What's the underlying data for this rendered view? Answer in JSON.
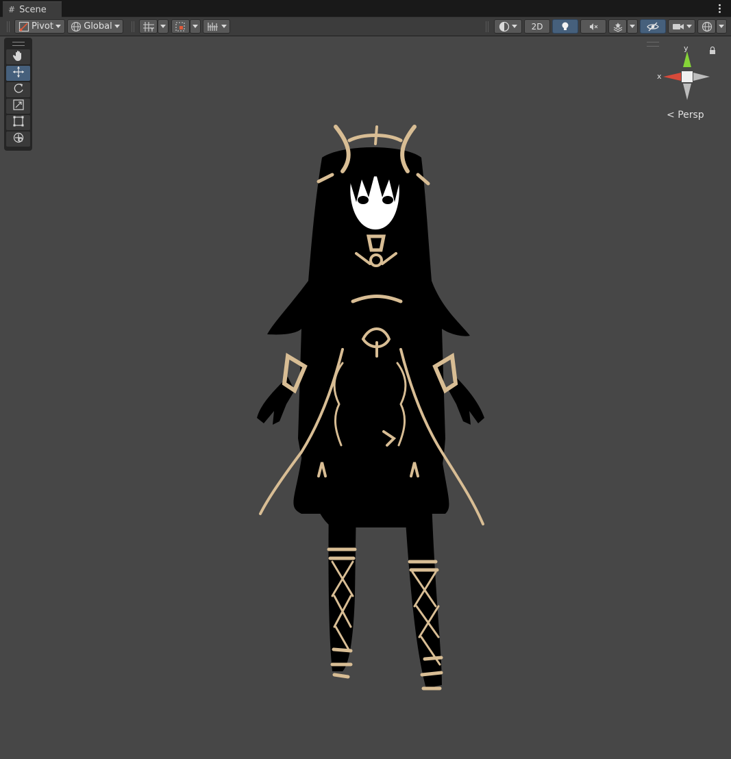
{
  "window": {
    "tab": {
      "label": "Scene",
      "icon": "scene-hash-icon"
    },
    "menu_icon": "kebab-menu-icon"
  },
  "toolbar": {
    "pivot_label": "Pivot",
    "global_label": "Global",
    "mode_2d_label": "2D",
    "lighting_active": true,
    "scene_visibility_active": true
  },
  "tools": [
    {
      "name": "view-tool",
      "icon": "hand-icon",
      "active": false
    },
    {
      "name": "move-tool",
      "icon": "move-arrows-icon",
      "active": true
    },
    {
      "name": "rotate-tool",
      "icon": "rotate-icon",
      "active": false
    },
    {
      "name": "scale-tool",
      "icon": "scale-icon",
      "active": false
    },
    {
      "name": "rect-tool",
      "icon": "rect-transform-icon",
      "active": false
    },
    {
      "name": "transform-tool",
      "icon": "transform-icon",
      "active": false
    }
  ],
  "gizmo": {
    "x_label": "x",
    "y_label": "y",
    "projection_label": "Persp",
    "colors": {
      "x": "#d84a3a",
      "y": "#86d438",
      "z": "#bdbdbd"
    }
  },
  "viewport": {
    "background": "#474747",
    "object_description_icon": "character-model",
    "colors": {
      "body": "#000000",
      "trim": "#d8bd94",
      "face": "#ffffff"
    }
  }
}
